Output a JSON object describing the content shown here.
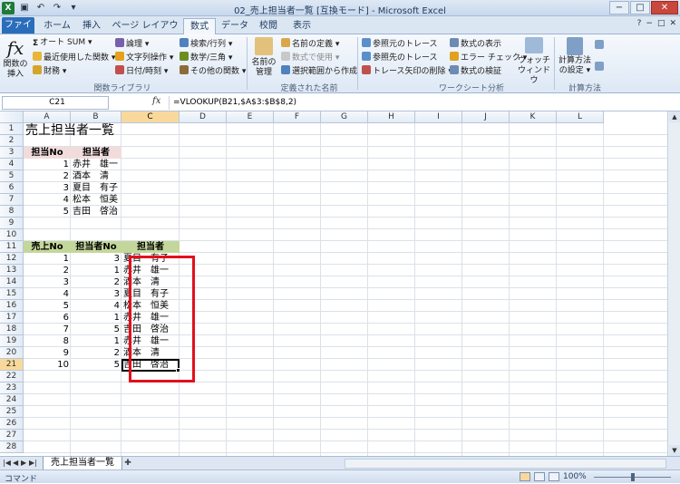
{
  "titlebar": {
    "title": "02_売上担当者一覧 [互換モード] - Microsoft Excel",
    "qat_icons": [
      "excel-icon",
      "save-icon",
      "undo-icon",
      "redo-icon",
      "customize-icon"
    ],
    "controls": [
      "−",
      "□",
      "✕"
    ]
  },
  "tabs": {
    "file": "ファイル",
    "items": [
      "ホーム",
      "挿入",
      "ページ レイアウト",
      "数式",
      "データ",
      "校閲",
      "表示"
    ],
    "active": "数式"
  },
  "ribbon": {
    "insert_function": "関数の\n挿入",
    "lib": {
      "autosum": "オート SUM ▾",
      "recent": "最近使用した関数 ▾",
      "finance": "財務 ▾",
      "logic": "論理 ▾",
      "text": "文字列操作 ▾",
      "date": "日付/時刻 ▾",
      "lookup": "検索/行列 ▾",
      "math": "数学/三角 ▾",
      "other": "その他の関数 ▾",
      "group": "関数ライブラリ"
    },
    "names": {
      "manager": "名前の\n管理",
      "define": "名前の定義 ▾",
      "use": "数式で使用 ▾",
      "create": "選択範囲から作成",
      "group": "定義された名前"
    },
    "audit": {
      "precedents": "参照元のトレース",
      "dependents": "参照先のトレース",
      "remove": "トレース矢印の削除 ▾",
      "show": "数式の表示",
      "error": "エラー チェック ▾",
      "evaluate": "数式の検証",
      "watch": "ウォッチ\nウィンドウ",
      "group": "ワークシート分析"
    },
    "calc": {
      "options": "計算方法\nの設定 ▾",
      "group": "計算方法"
    }
  },
  "formula_bar": {
    "name_box": "C21",
    "fx": "fx",
    "formula": "=VLOOKUP(B21,$A$3:$B$8,2)"
  },
  "columns": [
    "A",
    "B",
    "C",
    "D",
    "E",
    "F",
    "G",
    "H",
    "I",
    "J",
    "K",
    "L"
  ],
  "rows": [
    "1",
    "2",
    "3",
    "4",
    "5",
    "6",
    "7",
    "8",
    "9",
    "10",
    "11",
    "12",
    "13",
    "14",
    "15",
    "16",
    "17",
    "18",
    "19",
    "20",
    "21",
    "22",
    "23",
    "24",
    "25",
    "26",
    "27",
    "28"
  ],
  "sheet": {
    "title": "売上担当者一覧",
    "lookup_headers": [
      "担当No",
      "担当者"
    ],
    "lookup": [
      [
        "1",
        "赤井　雄一"
      ],
      [
        "2",
        "酒本　清"
      ],
      [
        "3",
        "夏目　有子"
      ],
      [
        "4",
        "松本　恒美"
      ],
      [
        "5",
        "吉田　啓治"
      ]
    ],
    "sales_headers": [
      "売上No",
      "担当者No",
      "担当者"
    ],
    "sales": [
      [
        "1",
        "3",
        "夏目　有子"
      ],
      [
        "2",
        "1",
        "赤井　雄一"
      ],
      [
        "3",
        "2",
        "酒本　清"
      ],
      [
        "4",
        "3",
        "夏目　有子"
      ],
      [
        "5",
        "4",
        "松本　恒美"
      ],
      [
        "6",
        "1",
        "赤井　雄一"
      ],
      [
        "7",
        "5",
        "吉田　啓治"
      ],
      [
        "8",
        "1",
        "赤井　雄一"
      ],
      [
        "9",
        "2",
        "酒本　清"
      ],
      [
        "10",
        "5",
        "吉田　啓治"
      ]
    ]
  },
  "sheet_tabs": {
    "active": "売上担当者一覧"
  },
  "status": {
    "mode": "コマンド",
    "zoom": "100%",
    "zoom_level_percent": 100
  },
  "colors": {
    "header_pink": "#f2dcdb",
    "header_green": "#c4d79b",
    "highlight": "#e3101c",
    "selected_header": "#f9d99b"
  }
}
